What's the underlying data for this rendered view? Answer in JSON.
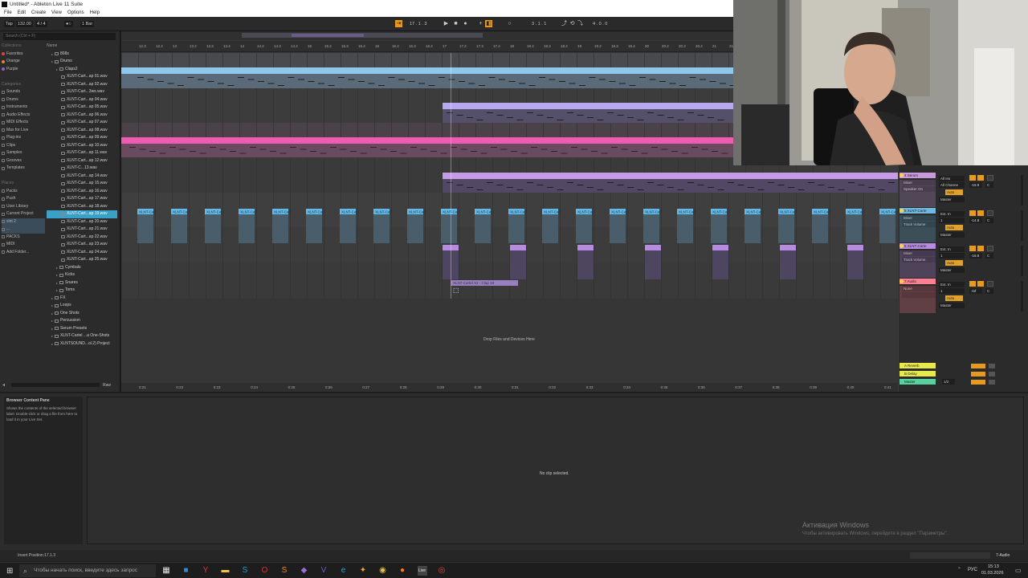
{
  "window": {
    "title": "Untitled* - Ableton Live 11 Suite"
  },
  "menu": [
    "File",
    "Edit",
    "Create",
    "View",
    "Options",
    "Help"
  ],
  "control_bar": {
    "tap": "Tap",
    "tempo": "132.00",
    "time_sig": "4 / 4",
    "metronome": "●○",
    "quantize": "1 Bar",
    "position": "17 . 1 . 3",
    "loop_start": "3 . 1 . 1",
    "loop_length": "4 . 0 . 0"
  },
  "browser": {
    "search_placeholder": "Search (Ctrl + F)",
    "collections_header": "Collections",
    "collections": [
      {
        "label": "Favorites",
        "color": "#e04040"
      },
      {
        "label": "Orange",
        "color": "#e08a20"
      },
      {
        "label": "Purple",
        "color": "#9060d0"
      }
    ],
    "categories_header": "Categories",
    "categories": [
      "Sounds",
      "Drums",
      "Instruments",
      "Audio Effects",
      "MIDI Effects",
      "Max for Live",
      "Plug-ins",
      "Clips",
      "Samples",
      "Grooves",
      "Templates"
    ],
    "places_header": "Places",
    "places": [
      "Packs",
      "Push",
      "User Library",
      "Current Project",
      "xlnt 2",
      "...",
      "PACKS",
      "MIDI",
      "Add Folder..."
    ],
    "name_header": "Name",
    "tree": [
      {
        "label": "808s",
        "indent": 1,
        "folder": true
      },
      {
        "label": "Drums",
        "indent": 1,
        "folder": true
      },
      {
        "label": "Claps2",
        "indent": 2,
        "folder": true
      },
      {
        "label": "XLNT-Cart...ap 01.wav",
        "indent": 3
      },
      {
        "label": "XLNT-Cart...ap 02.wav",
        "indent": 3
      },
      {
        "label": "XLNT-Cart...3ws.wav",
        "indent": 3
      },
      {
        "label": "XLNT-Cart...ap 04.wav",
        "indent": 3
      },
      {
        "label": "XLNT-Cart...ap 05.wav",
        "indent": 3
      },
      {
        "label": "XLNT-Cart...ap 06.wav",
        "indent": 3
      },
      {
        "label": "XLNT-Cart...ap 07.wav",
        "indent": 3
      },
      {
        "label": "XLNT-Cart...ap 08.wav",
        "indent": 3
      },
      {
        "label": "XLNT-Cart...ap 09.wav",
        "indent": 3
      },
      {
        "label": "XLNT-Cart...ap 10.wav",
        "indent": 3
      },
      {
        "label": "XLNT-Cart...ap 11.wav",
        "indent": 3
      },
      {
        "label": "XLNT-Cart...ap 12.wav",
        "indent": 3
      },
      {
        "label": "XLNT-C...13.wav",
        "indent": 3
      },
      {
        "label": "XLNT-Cart...ap 14.wav",
        "indent": 3
      },
      {
        "label": "XLNT-Cart...ap 15.wav",
        "indent": 3
      },
      {
        "label": "XLNT-Cart...ap 16.wav",
        "indent": 3
      },
      {
        "label": "XLNT-Cart...ap 17.wav",
        "indent": 3
      },
      {
        "label": "XLNT-Cart...ap 18.wav",
        "indent": 3
      },
      {
        "label": "XLNT-Cart...ap 19.wav",
        "indent": 3,
        "selected": true
      },
      {
        "label": "XLNT-Cart...ap 20.wav",
        "indent": 3
      },
      {
        "label": "XLNT-Cart...ap 21.wav",
        "indent": 3
      },
      {
        "label": "XLNT-Cart...ap 22.wav",
        "indent": 3
      },
      {
        "label": "XLNT-Cart...ap 23.wav",
        "indent": 3
      },
      {
        "label": "XLNT-Cart...ap 24.wav",
        "indent": 3
      },
      {
        "label": "XLNT-Cart...ap 25.wav",
        "indent": 3
      },
      {
        "label": "Cymbals",
        "indent": 2,
        "folder": true
      },
      {
        "label": "Kicks",
        "indent": 2,
        "folder": true
      },
      {
        "label": "Snares",
        "indent": 2,
        "folder": true
      },
      {
        "label": "Toms",
        "indent": 2,
        "folder": true
      },
      {
        "label": "FX",
        "indent": 1,
        "folder": true
      },
      {
        "label": "Loops",
        "indent": 1,
        "folder": true
      },
      {
        "label": "One Shots",
        "indent": 1,
        "folder": true
      },
      {
        "label": "Percussion",
        "indent": 1,
        "folder": true
      },
      {
        "label": "Serum Presets",
        "indent": 1,
        "folder": true
      },
      {
        "label": "XLNT-Cartel ...a One-Shots",
        "indent": 1,
        "folder": true
      },
      {
        "label": "XLNTSOUND...ol.2) Project",
        "indent": 1,
        "folder": true
      }
    ],
    "raw_label": "Raw"
  },
  "arrangement": {
    "bar_labels": [
      "12.3",
      "12.4",
      "13",
      "13.2",
      "13.3",
      "13.4",
      "14",
      "14.2",
      "14.3",
      "14.4",
      "15",
      "15.2",
      "15.3",
      "15.4",
      "16",
      "16.2",
      "16.3",
      "16.4",
      "17",
      "17.2",
      "17.3",
      "17.4",
      "18",
      "18.2",
      "18.3",
      "18.4",
      "19",
      "19.2",
      "19.3",
      "19.4",
      "20",
      "20.2",
      "20.3",
      "20.4",
      "21",
      "21.2"
    ],
    "time_labels": [
      "0:21",
      "0:22",
      "0:23",
      "0:24",
      "0:25",
      "0:26",
      "0:27",
      "0:28",
      "0:29",
      "0:30",
      "0:31",
      "0:32",
      "0:33",
      "0:34",
      "0:35",
      "0:36",
      "0:37",
      "0:38",
      "0:39",
      "0:40",
      "0:41"
    ],
    "clip_label": "XLNT-Cart",
    "dragged_clip": "XLNT-Cartel X2 - Clap 19",
    "drop_hint": "Drop Files and Devices Here"
  },
  "mixer": {
    "tracks": [
      {
        "name": "4 Serum",
        "color": "#c89ad8",
        "input": "All Ins",
        "channel": "All Channe",
        "monitor": "Auto",
        "output": "Master",
        "vol": "-15.9",
        "pan": "C",
        "sub": "Mixer",
        "sub2": "Speaker On"
      },
      {
        "name": "5 XLNT-Carte",
        "color": "#6fb8e0",
        "input": "Ext. In",
        "channel": "1",
        "monitor": "Auto",
        "output": "Master",
        "vol": "-14.8",
        "pan": "C",
        "sub": "Mixer",
        "sub2": "Track Volume"
      },
      {
        "name": "6 XLNT-Carte",
        "color": "#b88ae0",
        "input": "Ext. In",
        "channel": "1",
        "monitor": "Auto",
        "output": "Master",
        "vol": "-16.8",
        "pan": "C",
        "sub": "Mixer",
        "sub2": "Track Volume"
      },
      {
        "name": "7 Audio",
        "color": "#ff8090",
        "input": "Ext. In",
        "channel": "1",
        "monitor": "Auto",
        "output": "Master",
        "vol": "-inf",
        "pan": "C",
        "sub": "None",
        "sub2": ""
      }
    ],
    "returns": [
      {
        "name": "A Reverb",
        "color": "#e8e84a"
      },
      {
        "name": "B Delay",
        "color": "#e8e84a"
      },
      {
        "name": "Master",
        "color": "#58d0a0"
      }
    ],
    "cue": "1/2"
  },
  "info_view": {
    "title": "Browser Content Pane",
    "body": "Shows the contents of the selected browser label. Double-click or drag a file from here to load it in your Live Set."
  },
  "clip_view": {
    "empty_text": "No clip selected."
  },
  "status": {
    "text": "Insert Position:17.1.3",
    "track": "7-Audio"
  },
  "watermark": {
    "line1": "Активация Windows",
    "line2": "Чтобы активировать Windows, перейдите в раздел \"Параметры\"."
  },
  "taskbar": {
    "search_placeholder": "Чтобы начать поиск, введите здесь запрос",
    "lang": "РУС",
    "time": "15:13",
    "date": "01.03.2026",
    "app_icons": [
      {
        "name": "task-view-icon",
        "color": "#e6e6e6",
        "glyph": "▦"
      },
      {
        "name": "store-icon",
        "color": "#2d8ce0",
        "glyph": "■"
      },
      {
        "name": "yandex-icon",
        "color": "#e8332b",
        "glyph": "Y"
      },
      {
        "name": "explorer-icon",
        "color": "#f2c14e",
        "glyph": "▬"
      },
      {
        "name": "skype-icon",
        "color": "#14a0e6",
        "glyph": "S"
      },
      {
        "name": "opera-icon",
        "color": "#e0302b",
        "glyph": "O"
      },
      {
        "name": "sublime-icon",
        "color": "#f28b25",
        "glyph": "S"
      },
      {
        "name": "app-icon",
        "color": "#9b6bd8",
        "glyph": "◆"
      },
      {
        "name": "viber-icon",
        "color": "#7a52c8",
        "glyph": "V"
      },
      {
        "name": "edge-icon",
        "color": "#1ba9d8",
        "glyph": "e"
      },
      {
        "name": "fl-studio-icon",
        "color": "#f5a623",
        "glyph": "✦"
      },
      {
        "name": "antares-icon",
        "color": "#e8c440",
        "glyph": "◉"
      },
      {
        "name": "firefox-icon",
        "color": "#ff7a1a",
        "glyph": "●"
      },
      {
        "name": "ableton-icon",
        "color": "#dddddd",
        "glyph": "Live"
      },
      {
        "name": "chrome-icon",
        "color": "#de4a3b",
        "glyph": "◎"
      }
    ]
  },
  "colors": {
    "accent": "#ffaa00",
    "selection": "#3aa0c8"
  }
}
